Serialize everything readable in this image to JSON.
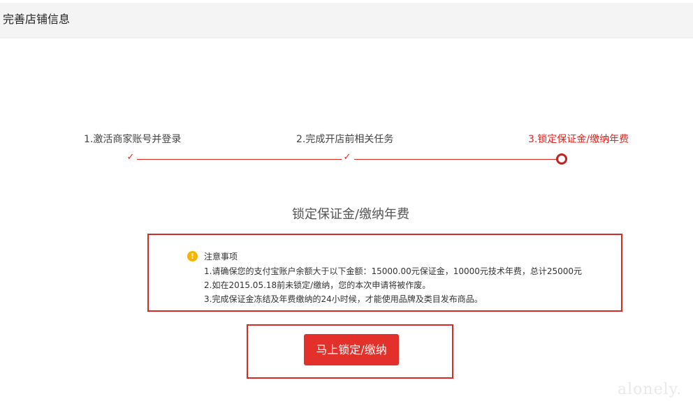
{
  "header": {
    "title": "完善店铺信息"
  },
  "steps": [
    {
      "label": "1.激活商家账号并登录",
      "status": "done",
      "icon": "check-icon"
    },
    {
      "label": "2.完成开店前相关任务",
      "status": "done",
      "icon": "check-icon"
    },
    {
      "label": "3.锁定保证金/缴纳年费",
      "status": "current",
      "icon": "current-step-dot"
    }
  ],
  "colors": {
    "accent": "#e0251f",
    "button": "#e3302a",
    "warning": "#f5b400",
    "highlight_border": "#d52b26"
  },
  "section": {
    "title": "锁定保证金/缴纳年费"
  },
  "notice": {
    "icon": "warning-icon",
    "title": "注意事项",
    "lines": [
      "1.请确保您的支付宝账户余额大于以下金额：15000.00元保证金，10000元技术年费，总计25000元",
      "2.如在2015.05.18前未锁定/缴纳，您的本次申请将被作废。",
      "3.完成保证金冻结及年费缴纳的24小时候，才能使用品牌及类目发布商品。"
    ]
  },
  "action": {
    "button_label": "马上锁定/缴纳"
  },
  "watermark": "alonely."
}
